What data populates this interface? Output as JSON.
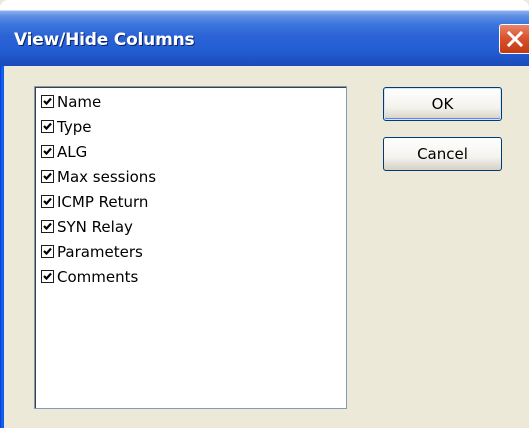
{
  "window": {
    "title": "View/Hide Columns",
    "close_icon": "close-icon",
    "accent_color": "#245ed3",
    "close_color": "#d9532e"
  },
  "columns": [
    {
      "label": "Name",
      "checked": true
    },
    {
      "label": "Type",
      "checked": true
    },
    {
      "label": "ALG",
      "checked": true
    },
    {
      "label": "Max sessions",
      "checked": true
    },
    {
      "label": "ICMP Return",
      "checked": true
    },
    {
      "label": "SYN Relay",
      "checked": true
    },
    {
      "label": "Parameters",
      "checked": true
    },
    {
      "label": "Comments",
      "checked": true
    }
  ],
  "buttons": {
    "ok_label": "OK",
    "cancel_label": "Cancel"
  }
}
